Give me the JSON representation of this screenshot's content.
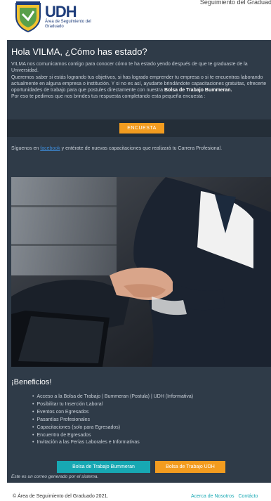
{
  "header": {
    "logo_text": "UDH",
    "logo_subtitle": "Área de Seguimiento del Graduado",
    "top_right": "Seguimiento del Graduado"
  },
  "greeting": "Hola VILMA, ¿Cómo has estado?",
  "intro": {
    "p1": "VILMA nos comunicamos contigo para conocer cómo te ha estado yendo después de que te graduaste de la Universidad.",
    "p2_start": "Queremos saber si estás logrando tus objetivos, si has logrado emprender tu empresa o si te encuentras laborando actualmente en alguna empresa o institución. Y si no es así, ayudarte brindándote capacitaciones gratuitas, ofrecerte oportunidades de trabajo para que postules directamente con nuestra",
    "p2_bold": "Bolsa de Trabajo Bummeran.",
    "p3": "Por eso te pedimos que nos brindes tus respuesta completando esta pequeña encuesta :"
  },
  "encuesta_button": "ENCUESTA",
  "social": {
    "before": "Síguenos en ",
    "link": "facebook",
    "after": " y entérate de nuevas capacitaciones que realizará tu Carrera Profesional."
  },
  "benefits": {
    "title": "¡Beneficios!",
    "items": [
      "Acceso a la Bolsa de Trabajo | Bummeran (Postula) | UDH (Informativa)",
      "Posibilitar tu Inserción Laboral",
      "Eventos con Egresados",
      "Pasantías Profesionales",
      "Capacitaciones (solo para Egresados)",
      "Encuentro de Egresados",
      "Invitación a las Ferias Laborales e Informativas"
    ]
  },
  "buttons": {
    "bummeran": "Bolsa de Trabajo Bummeran",
    "udh": "Bolsa de Trabajo UDH"
  },
  "auto_note": "Este es un correo generado por el sistema.",
  "footer": {
    "copyright": "© Área de Seguimiento del Graduado 2021.",
    "link_about": "Acerca de Nosotros",
    "link_contact": "Contácto"
  },
  "colors": {
    "card_bg": "#2f3b48",
    "accent_orange": "#f39c1f",
    "accent_teal": "#17a8b3",
    "link_blue": "#3d8bd8"
  }
}
